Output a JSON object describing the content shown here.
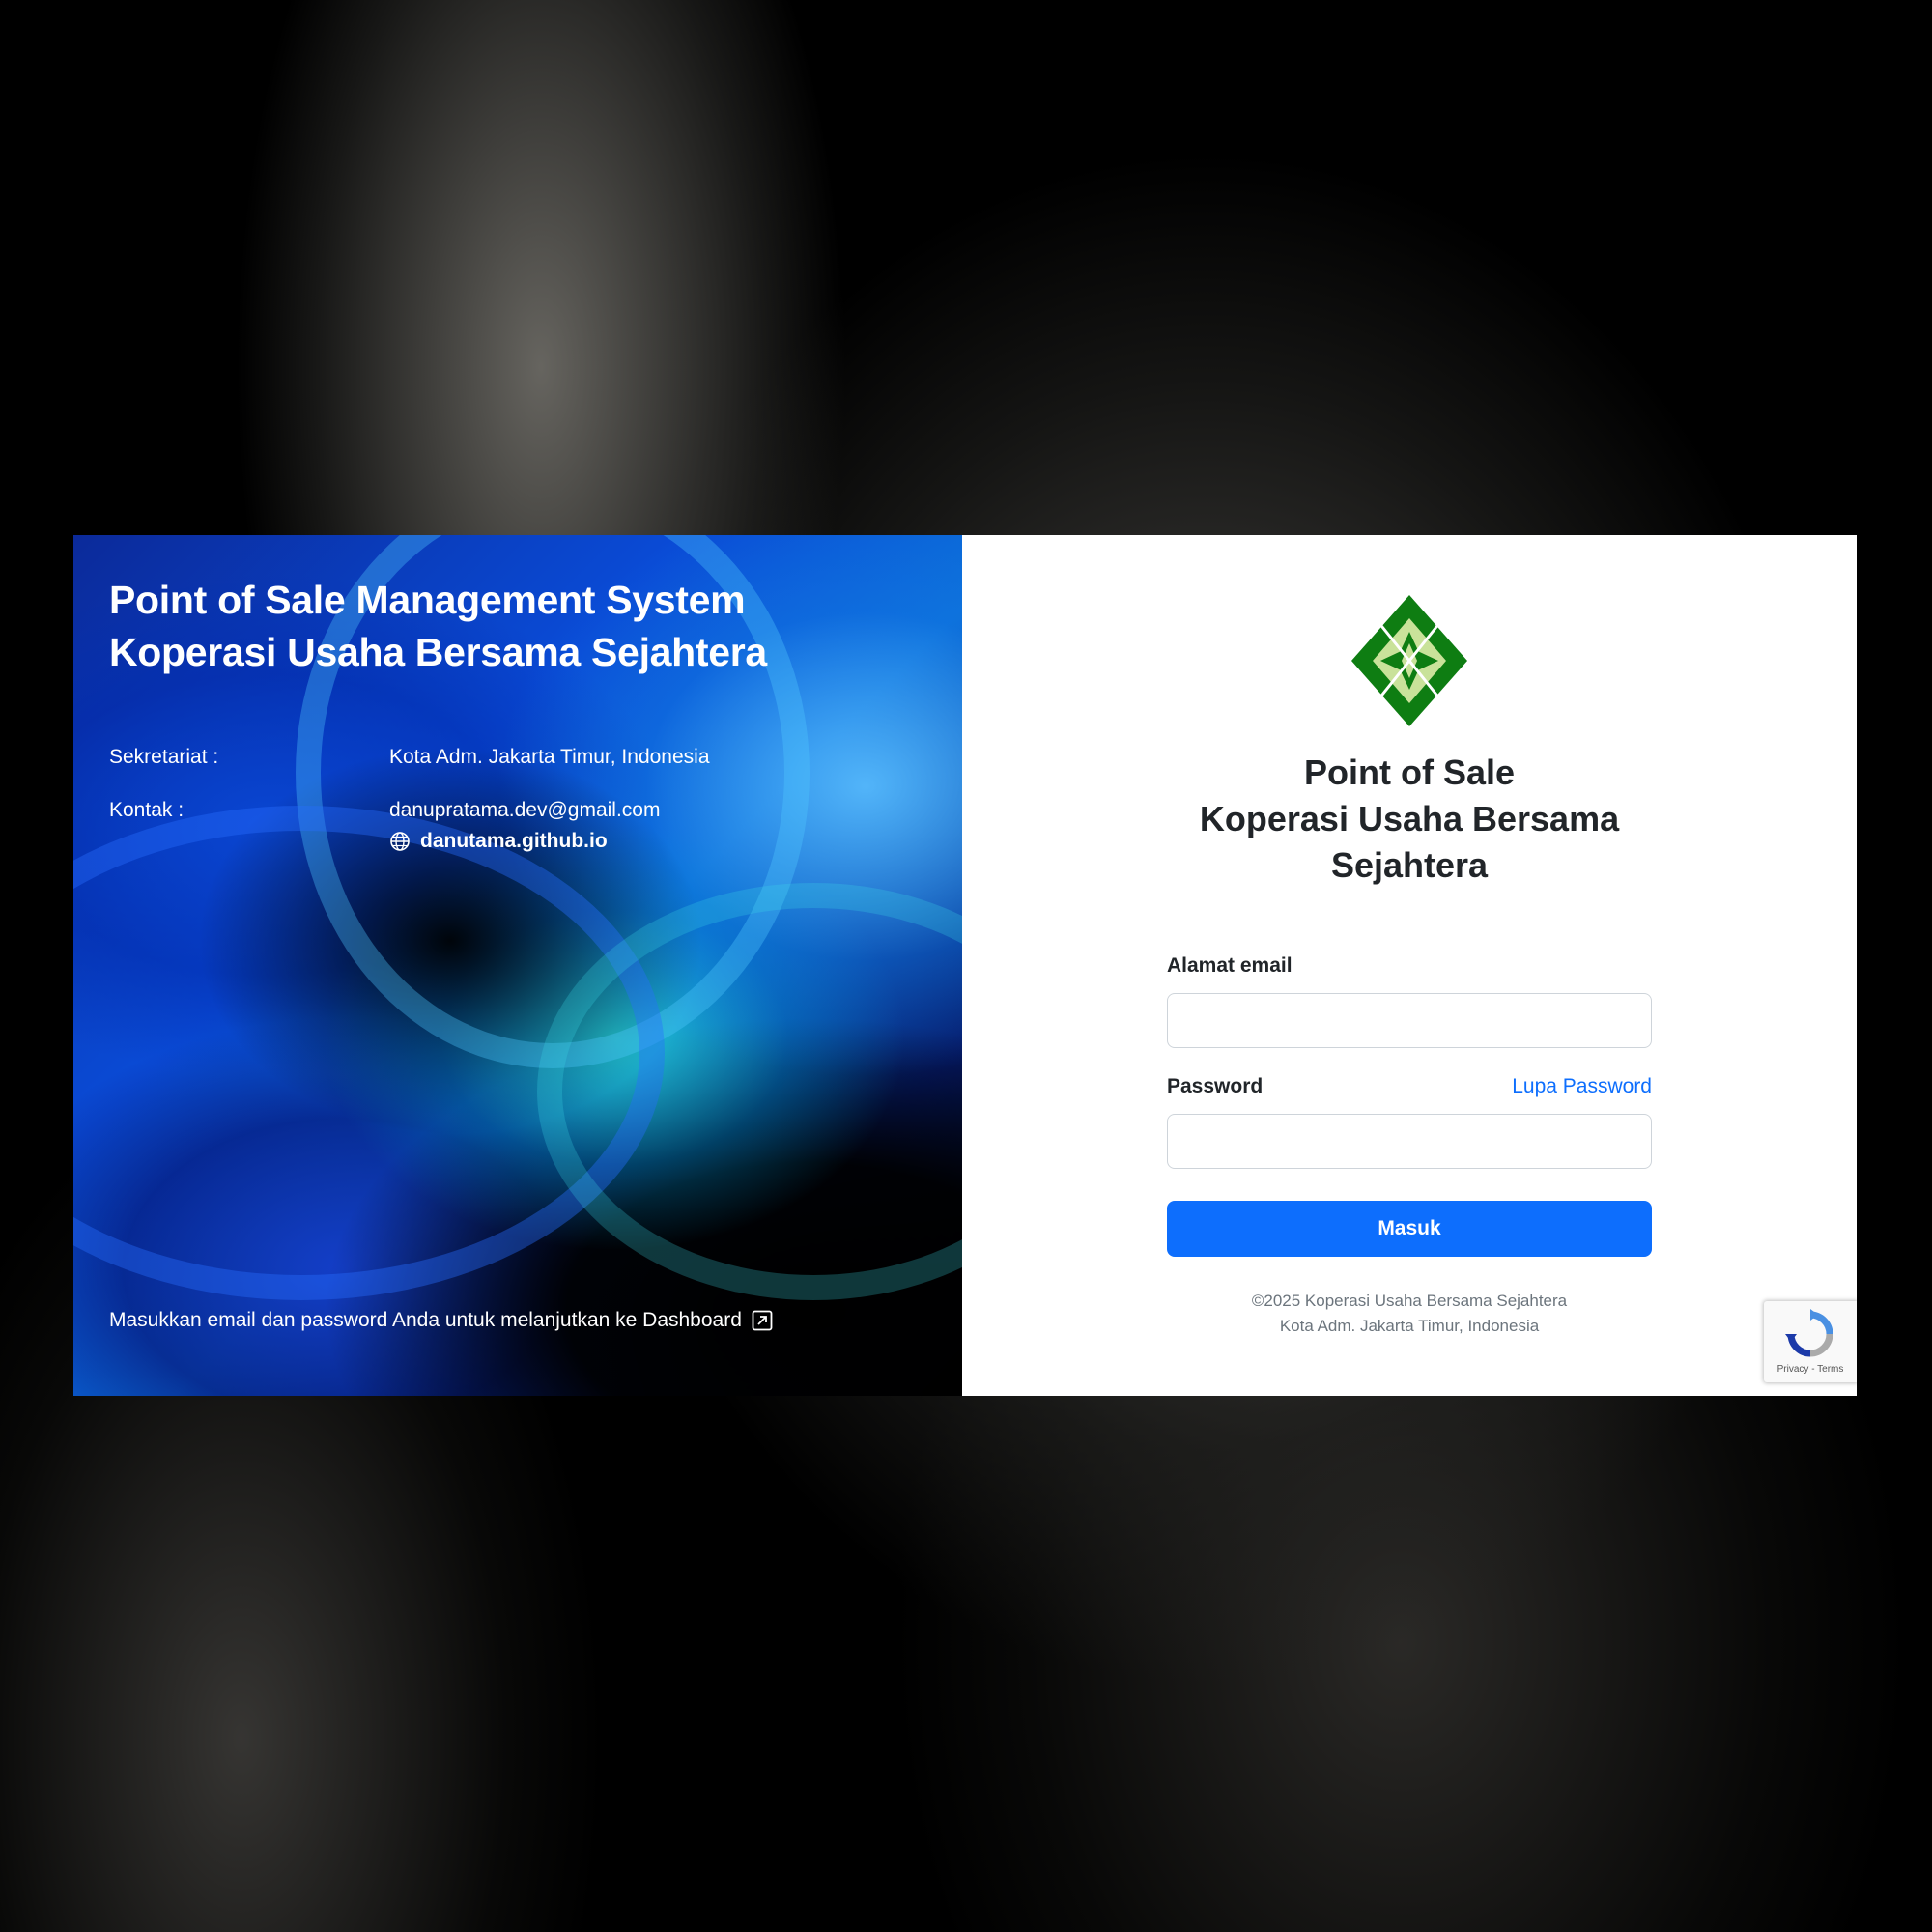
{
  "left_panel": {
    "title_line1": "Point of Sale Management System",
    "title_line2": "Koperasi Usaha Bersama Sejahtera",
    "secretariat_label": "Sekretariat :",
    "secretariat_value": "Kota Adm. Jakarta Timur, Indonesia",
    "contact_label": "Kontak :",
    "contact_email": "danupratama.dev@gmail.com",
    "contact_website": "danutama.github.io",
    "footer_text": "Masukkan email dan password Anda untuk melanjutkan ke Dashboard",
    "icons": {
      "website": "globe-icon",
      "footer": "external-link-icon"
    }
  },
  "right_panel": {
    "title_line1": "Point of Sale",
    "title_line2": "Koperasi Usaha Bersama",
    "title_line3": "Sejahtera",
    "email_label": "Alamat email",
    "email_value": "",
    "password_label": "Password",
    "password_value": "",
    "forgot_password": "Lupa Password",
    "submit_label": "Masuk",
    "copyright_line1": "©2025 Koperasi Usaha Bersama Sejahtera",
    "copyright_line2": "Kota Adm. Jakarta Timur, Indonesia",
    "logo": "cooperative-logo"
  },
  "recaptcha": {
    "privacy": "Privacy",
    "separator": " - ",
    "terms": "Terms"
  },
  "colors": {
    "primary": "#0d6efd",
    "logo_dark_green": "#0e7d12",
    "logo_light_green": "#c9e29a",
    "page_background": "#000000"
  }
}
